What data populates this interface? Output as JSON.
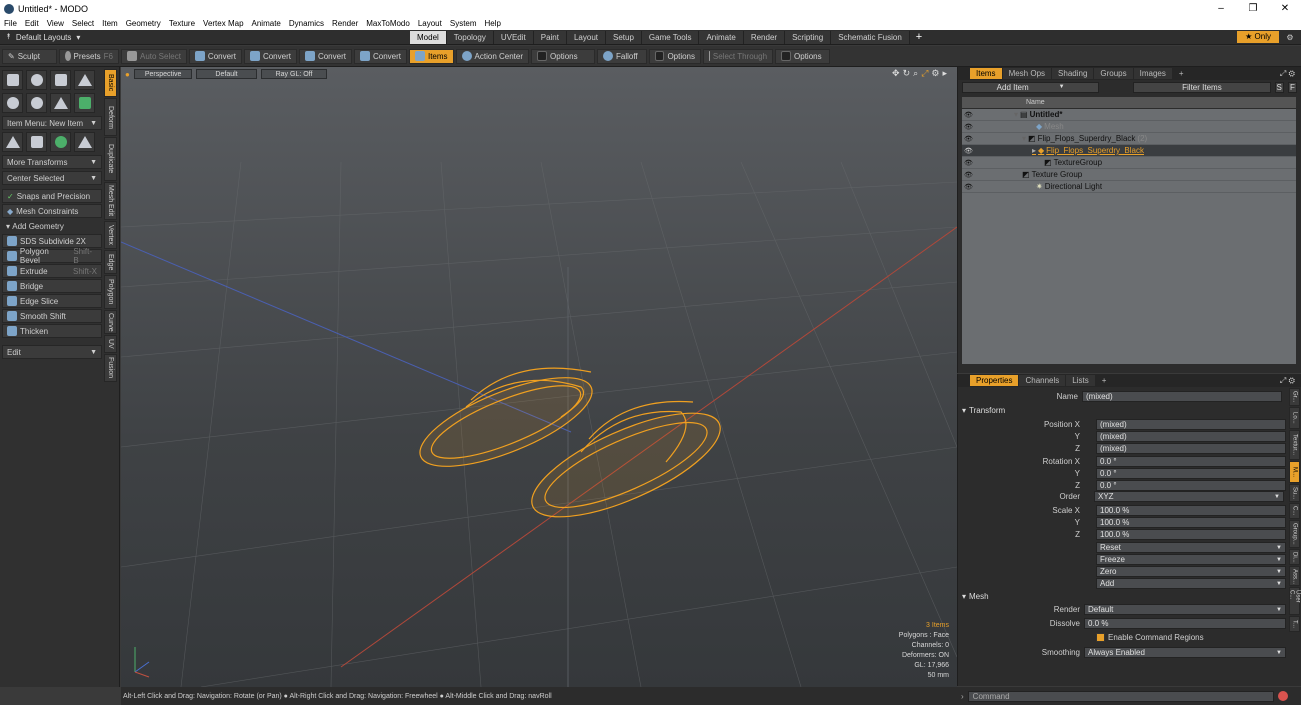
{
  "window": {
    "title": "Untitled* - MODO",
    "controls": [
      "–",
      "❐",
      "✕"
    ]
  },
  "menu": [
    "File",
    "Edit",
    "View",
    "Select",
    "Item",
    "Geometry",
    "Texture",
    "Vertex Map",
    "Animate",
    "Dynamics",
    "Render",
    "MaxToModo",
    "Layout",
    "System",
    "Help"
  ],
  "layoutbar": {
    "default_layouts": "Default Layouts",
    "tabs": [
      "Model",
      "Topology",
      "UVEdit",
      "Paint",
      "Layout",
      "Setup",
      "Game Tools",
      "Animate",
      "Render",
      "Scripting",
      "Schematic Fusion"
    ],
    "active_tab": 0,
    "plus": "+",
    "only_label": "★ Only"
  },
  "toolbar": {
    "sculpt": "Sculpt",
    "presets": "Presets",
    "presets_key": "F6",
    "auto_select": "Auto Select",
    "convert1": "Convert",
    "convert2": "Convert",
    "convert3": "Convert",
    "convert4": "Convert",
    "items": "Items",
    "action_center": "Action Center",
    "options1": "Options",
    "falloff": "Falloff",
    "options2": "Options",
    "select_through": "Select Through",
    "options3": "Options"
  },
  "leftpanel": {
    "item_menu": "Item Menu: New Item",
    "more_transforms": "More Transforms",
    "center_selected": "Center Selected",
    "snaps": "Snaps and Precision",
    "mesh_constraints": "Mesh Constraints",
    "add_geometry": "Add Geometry",
    "buttons": [
      {
        "label": "SDS Subdivide 2X",
        "shortcut": ""
      },
      {
        "label": "Polygon Bevel",
        "shortcut": "Shift-B"
      },
      {
        "label": "Extrude",
        "shortcut": "Shift-X"
      },
      {
        "label": "Bridge",
        "shortcut": ""
      },
      {
        "label": "Edge Slice",
        "shortcut": ""
      },
      {
        "label": "Smooth Shift",
        "shortcut": ""
      },
      {
        "label": "Thicken",
        "shortcut": ""
      }
    ],
    "edit": "Edit",
    "vtabs": [
      "Basic",
      "Deform",
      "Duplicate",
      "Mesh Edit",
      "Vertex",
      "Edge",
      "Polygon",
      "Curve",
      "UV",
      "Fusion"
    ]
  },
  "viewport": {
    "view": "Perspective",
    "style": "Default",
    "raygl": "Ray GL: Off",
    "stats": {
      "items": "3 Items",
      "polygons": "Polygons : Face",
      "channels": "Channels: 0",
      "deformers": "Deformers: ON",
      "gl": "GL: 17,966",
      "mm": "50 mm"
    }
  },
  "statusbar": "Alt-Left Click and Drag: Navigation: Rotate (or Pan) ● Alt-Right Click and Drag: Navigation: Freewheel ● Alt-Middle Click and Drag: navRoll",
  "items_panel": {
    "tabs": [
      "Items",
      "Mesh Ops",
      "Shading",
      "Groups",
      "Images",
      "+"
    ],
    "add_item": "Add Item",
    "filter": "Filter Items",
    "sf": [
      "S",
      "F"
    ],
    "column": "Name",
    "rows": [
      {
        "label": "Untitled*",
        "suffix": "",
        "indent": 0
      },
      {
        "label": "Mesh",
        "suffix": "",
        "indent": 1
      },
      {
        "label": "Flip_Flops_Superdry_Black",
        "suffix": "(2)",
        "indent": 1
      },
      {
        "label": "Flip_Flops_Superdry_Black",
        "suffix": "",
        "indent": 2
      },
      {
        "label": "TextureGroup",
        "suffix": "",
        "indent": 2
      },
      {
        "label": "Texture Group",
        "suffix": "",
        "indent": 1
      },
      {
        "label": "Directional Light",
        "suffix": "",
        "indent": 1
      }
    ]
  },
  "props_panel": {
    "tabs": [
      "Properties",
      "Channels",
      "Lists",
      "+"
    ],
    "name_label": "Name",
    "name_value": "(mixed)",
    "transform": "Transform",
    "position_label": "Position X",
    "pos": [
      "(mixed)",
      "(mixed)",
      "(mixed)"
    ],
    "rotation_label": "Rotation X",
    "rot": [
      "0.0 °",
      "0.0 °",
      "0.0 °"
    ],
    "y": "Y",
    "z": "Z",
    "order_label": "Order",
    "order": "XYZ",
    "scale_label": "Scale X",
    "scale": [
      "100.0 %",
      "100.0 %",
      "100.0 %"
    ],
    "actions": [
      "Reset",
      "Freeze",
      "Zero",
      "Add"
    ],
    "mesh": "Mesh",
    "render_label": "Render",
    "render": "Default",
    "dissolve_label": "Dissolve",
    "dissolve": "0.0 %",
    "enable_cmd": "Enable Command Regions",
    "smoothing_label": "Smoothing",
    "smoothing": "Always Enabled",
    "vtabs": [
      "Gr...",
      "Lo...",
      "Textur...",
      "M...",
      "Su...",
      "C...",
      "Group...",
      "Di...",
      "Ass...",
      "User C...",
      "T..."
    ]
  },
  "command": "Command",
  "colors": {
    "accent": "#e8a02a",
    "wire": "#f0a020"
  }
}
